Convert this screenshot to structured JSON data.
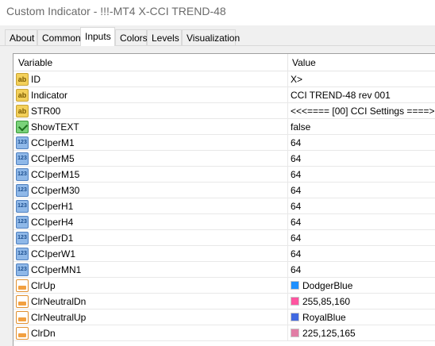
{
  "window": {
    "title": "Custom Indicator - !!!-MT4 X-CCI TREND-48"
  },
  "tabs": [
    {
      "label": "About"
    },
    {
      "label": "Common"
    },
    {
      "label": "Inputs"
    },
    {
      "label": "Colors"
    },
    {
      "label": "Levels"
    },
    {
      "label": "Visualization"
    }
  ],
  "active_tab": "Inputs",
  "grid": {
    "columns": {
      "variable": "Variable",
      "value": "Value"
    },
    "rows": [
      {
        "icon": "string-icon",
        "name": "ID",
        "value": "X>"
      },
      {
        "icon": "string-icon",
        "name": "Indicator",
        "value": "CCI TREND-48 rev 001"
      },
      {
        "icon": "string-icon",
        "name": "STR00",
        "value": "<<<==== [00] CCI Settings ====>>>"
      },
      {
        "icon": "bool-icon",
        "name": "ShowTEXT",
        "value": "false"
      },
      {
        "icon": "integer-icon",
        "name": "CCIperM1",
        "value": "64"
      },
      {
        "icon": "integer-icon",
        "name": "CCIperM5",
        "value": "64"
      },
      {
        "icon": "integer-icon",
        "name": "CCIperM15",
        "value": "64"
      },
      {
        "icon": "integer-icon",
        "name": "CCIperM30",
        "value": "64"
      },
      {
        "icon": "integer-icon",
        "name": "CCIperH1",
        "value": "64"
      },
      {
        "icon": "integer-icon",
        "name": "CCIperH4",
        "value": "64"
      },
      {
        "icon": "integer-icon",
        "name": "CCIperD1",
        "value": "64"
      },
      {
        "icon": "integer-icon",
        "name": "CCIperW1",
        "value": "64"
      },
      {
        "icon": "integer-icon",
        "name": "CCIperMN1",
        "value": "64"
      },
      {
        "icon": "color-icon",
        "name": "ClrUp",
        "value": "DodgerBlue",
        "swatch": "#1e90ff"
      },
      {
        "icon": "color-icon",
        "name": "ClrNeutralDn",
        "value": "255,85,160",
        "swatch": "#ff55a0"
      },
      {
        "icon": "color-icon",
        "name": "ClrNeutralUp",
        "value": "RoyalBlue",
        "swatch": "#4169e1"
      },
      {
        "icon": "color-icon",
        "name": "ClrDn",
        "value": "225,125,165",
        "swatch": "#e17da5"
      }
    ]
  }
}
